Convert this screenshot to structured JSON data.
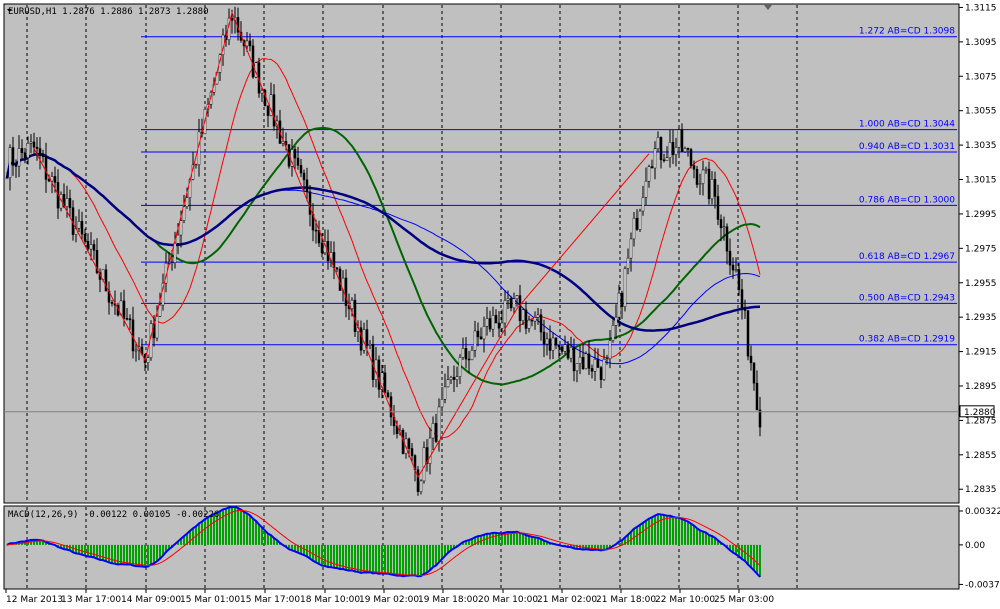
{
  "window": {
    "title": "EURUSD,H1  1.2876 1.2886 1.2873 1.2880",
    "macd_label": "MACD(12,26,9) -0.00122 0.00105 -0.00226",
    "current_price_label": "1.2880"
  },
  "colors": {
    "background": "#c0c0c0",
    "candle": "#000000",
    "fib_line": "#0000ff",
    "fib_text": "#0000ff",
    "zigzag": "#ff0000",
    "ma_red": "#ff0000",
    "ma_green": "#006400",
    "ma_blue_thin": "#0000ff",
    "ma_navy_thick": "#000080",
    "macd_hist": "#00a000",
    "macd_main": "#0000ff",
    "macd_signal": "#ff0000"
  },
  "chart_data": {
    "type": "candlestick",
    "symbol": "EURUSD",
    "timeframe": "H1",
    "ylim": [
      1.2827,
      1.3117
    ],
    "y_ticks": [
      "1.3115",
      "1.3095",
      "1.3075",
      "1.3055",
      "1.3035",
      "1.3015",
      "1.2995",
      "1.2975",
      "1.2955",
      "1.2935",
      "1.2915",
      "1.2895",
      "1.2875",
      "1.2855",
      "1.2835"
    ],
    "x_ticks": [
      "12 Mar 2013",
      "13 Mar 17:00",
      "14 Mar 09:00",
      "15 Mar 01:00",
      "15 Mar 17:00",
      "18 Mar 10:00",
      "19 Mar 02:00",
      "19 Mar 18:00",
      "20 Mar 10:00",
      "21 Mar 02:00",
      "21 Mar 18:00",
      "22 Mar 10:00",
      "25 Mar 03:00"
    ],
    "current_price": 1.288,
    "fib_levels": [
      {
        "label": "1.272 AB=CD  1.3098",
        "price": 1.3098
      },
      {
        "label": "1.000 AB=CD  1.3044",
        "price": 1.3044
      },
      {
        "label": "0.940 AB=CD  1.3031",
        "price": 1.3031
      },
      {
        "label": "0.786 AB=CD  1.3000",
        "price": 1.3
      },
      {
        "label": "0.618 AB=CD  1.2967",
        "price": 1.2967
      },
      {
        "label": "0.500 AB=CD  1.2943",
        "price": 1.2943
      },
      {
        "label": "0.382 AB=CD  1.2919",
        "price": 1.2919
      }
    ],
    "zigzag": [
      {
        "bar": 9,
        "price": 1.3033
      },
      {
        "bar": 46,
        "price": 1.291
      },
      {
        "bar": 75,
        "price": 1.3112
      },
      {
        "bar": 137,
        "price": 1.2842
      },
      {
        "bar": 170,
        "price": 1.294
      },
      {
        "bar": 214,
        "price": 1.303
      }
    ],
    "macd": {
      "ylim": [
        -0.0041,
        0.0036
      ],
      "y_ticks": [
        "0.00322",
        "0.00",
        "-0.00376"
      ]
    }
  }
}
